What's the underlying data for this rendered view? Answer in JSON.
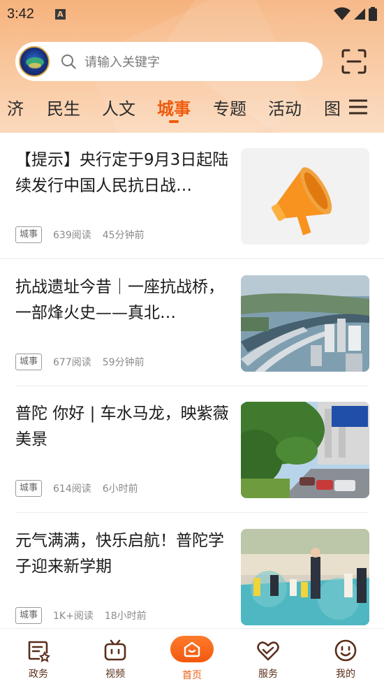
{
  "status_bar": {
    "time": "3:42",
    "notification_glyph": "A"
  },
  "search": {
    "placeholder": "请输入关键字"
  },
  "tabs": [
    {
      "label": "济"
    },
    {
      "label": "民生"
    },
    {
      "label": "人文"
    },
    {
      "label": "城事",
      "active": true
    },
    {
      "label": "专题"
    },
    {
      "label": "活动"
    },
    {
      "label": "图"
    }
  ],
  "articles": [
    {
      "title": "【提示】央行定于9月3日起陆续发行中国人民抗日战…",
      "tag": "城事",
      "reads": "639阅读",
      "time": "45分钟前",
      "thumb": "megaphone-image"
    },
    {
      "title": "抗战遗址今昔｜一座抗战桥，一部烽火史——真北…",
      "tag": "城事",
      "reads": "677阅读",
      "time": "59分钟前",
      "thumb": "aerial-city-photo"
    },
    {
      "title": "普陀 你好 | 车水马龙，映紫薇美景",
      "tag": "城事",
      "reads": "614阅读",
      "time": "6小时前",
      "thumb": "street-trees-photo"
    },
    {
      "title": "元气满满，快乐启航！普陀学子迎来新学期",
      "tag": "城事",
      "reads": "1K+阅读",
      "time": "18小时前",
      "thumb": "school-children-photo"
    }
  ],
  "bottom_nav": [
    {
      "label": "政务",
      "icon": "government-affairs-icon"
    },
    {
      "label": "视频",
      "icon": "video-tv-icon"
    },
    {
      "label": "首页",
      "icon": "home-icon",
      "active": true
    },
    {
      "label": "服务",
      "icon": "service-heart-icon"
    },
    {
      "label": "我的",
      "icon": "smiley-profile-icon"
    }
  ],
  "colors": {
    "accent": "#ef5b0c",
    "header": "#f6b27c",
    "nav_text": "#5b2e1a"
  }
}
